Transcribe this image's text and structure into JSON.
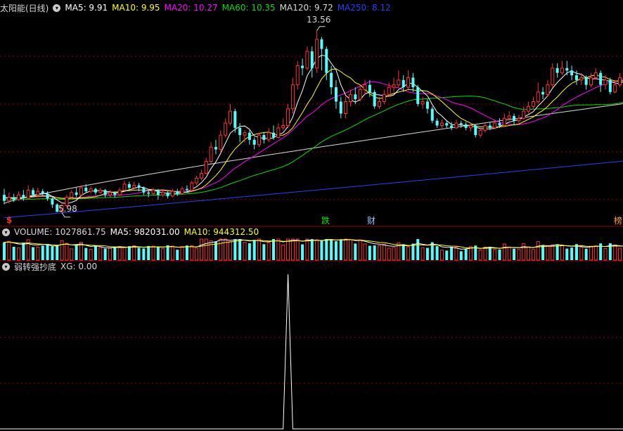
{
  "main": {
    "title": "太阳能(日线)",
    "ma": [
      {
        "label": "MA5: 9.91",
        "color": "#ffffff"
      },
      {
        "label": "MA10: 9.95",
        "color": "#ffff00"
      },
      {
        "label": "MA20: 10.27",
        "color": "#ff00ff"
      },
      {
        "label": "MA60: 10.35",
        "color": "#00e000"
      },
      {
        "label": "MA120: 9.72",
        "color": "#d8d8d8"
      },
      {
        "label": "MA250: 8.12",
        "color": "#2a3cff"
      }
    ],
    "high_label": "13.56",
    "low_label": "5.98",
    "markers": [
      {
        "text": "$",
        "color": "#ff3030"
      },
      {
        "text": "跌",
        "color": "#00e000"
      },
      {
        "text": "财",
        "color": "#9cc8ff"
      },
      {
        "text": "榜",
        "color": "#ffa040"
      }
    ]
  },
  "volume": {
    "title": "VOLUME: 1027861.75",
    "ma5": "MA5: 982031.00",
    "ma10": "MA10: 944312.50"
  },
  "indicator": {
    "title": "弱转强抄底",
    "xg": "XG: 0.00"
  },
  "colors": {
    "up": "#ff3232",
    "down": "#54fcfc",
    "grid": "#a00000",
    "separator": "#a00000"
  },
  "chart_data": {
    "type": "candlestick",
    "price_range": [
      5.5,
      14.2
    ],
    "candles": [
      [
        6.7,
        6.45,
        6.95,
        6.3
      ],
      [
        6.45,
        6.6,
        6.8,
        6.35
      ],
      [
        6.6,
        6.5,
        6.75,
        6.4
      ],
      [
        6.5,
        6.7,
        6.85,
        6.45
      ],
      [
        6.7,
        6.55,
        6.9,
        6.45
      ],
      [
        6.55,
        6.9,
        7.1,
        6.5
      ],
      [
        6.9,
        6.7,
        7.0,
        6.6
      ],
      [
        6.7,
        6.85,
        7.0,
        6.6
      ],
      [
        6.85,
        6.75,
        6.95,
        6.65
      ],
      [
        6.75,
        6.55,
        6.85,
        6.45
      ],
      [
        6.55,
        6.3,
        6.6,
        6.15
      ],
      [
        6.3,
        5.99,
        6.35,
        5.98
      ],
      [
        5.99,
        6.25,
        6.4,
        5.95
      ],
      [
        6.25,
        6.6,
        6.7,
        6.2
      ],
      [
        6.6,
        6.8,
        6.9,
        6.55
      ],
      [
        6.8,
        6.7,
        7.0,
        6.6
      ],
      [
        6.7,
        7.0,
        7.1,
        6.65
      ],
      [
        7.0,
        6.85,
        7.15,
        6.8
      ],
      [
        6.85,
        6.95,
        7.05,
        6.75
      ],
      [
        6.95,
        6.8,
        7.0,
        6.7
      ],
      [
        6.8,
        6.9,
        7.0,
        6.75
      ],
      [
        6.9,
        6.7,
        6.95,
        6.6
      ],
      [
        6.7,
        6.8,
        6.9,
        6.6
      ],
      [
        6.8,
        6.7,
        6.85,
        6.6
      ],
      [
        6.7,
        6.9,
        7.0,
        6.65
      ],
      [
        6.9,
        7.15,
        7.3,
        6.85
      ],
      [
        7.15,
        7.0,
        7.25,
        6.9
      ],
      [
        7.0,
        7.1,
        7.25,
        6.95
      ],
      [
        7.1,
        7.0,
        7.2,
        6.85
      ],
      [
        7.0,
        6.8,
        7.05,
        6.7
      ],
      [
        6.8,
        6.75,
        6.9,
        6.6
      ],
      [
        6.75,
        6.9,
        7.0,
        6.7
      ],
      [
        6.9,
        6.7,
        6.95,
        6.5
      ],
      [
        6.7,
        6.8,
        6.9,
        6.6
      ],
      [
        6.8,
        6.65,
        6.85,
        6.55
      ],
      [
        6.65,
        6.85,
        6.95,
        6.6
      ],
      [
        6.85,
        6.75,
        6.95,
        6.65
      ],
      [
        6.75,
        6.95,
        7.05,
        6.7
      ],
      [
        6.95,
        6.9,
        7.1,
        6.8
      ],
      [
        6.9,
        7.2,
        7.3,
        6.85
      ],
      [
        7.2,
        7.4,
        7.5,
        7.1
      ],
      [
        7.4,
        7.6,
        7.75,
        7.3
      ],
      [
        7.6,
        8.1,
        8.25,
        7.55
      ],
      [
        8.1,
        8.7,
        8.9,
        8.0
      ],
      [
        8.7,
        8.6,
        9.0,
        8.4
      ],
      [
        8.6,
        9.2,
        9.4,
        8.5
      ],
      [
        9.2,
        9.7,
        9.9,
        9.1
      ],
      [
        9.7,
        10.2,
        10.5,
        9.6
      ],
      [
        10.2,
        9.5,
        10.3,
        9.3
      ],
      [
        9.5,
        9.2,
        9.7,
        8.9
      ],
      [
        9.2,
        9.3,
        9.4,
        8.9
      ],
      [
        9.3,
        9.0,
        9.4,
        8.8
      ],
      [
        9.0,
        8.8,
        9.1,
        8.6
      ],
      [
        8.8,
        9.2,
        9.3,
        8.7
      ],
      [
        9.2,
        9.0,
        9.3,
        8.85
      ],
      [
        9.0,
        9.3,
        9.5,
        8.9
      ],
      [
        9.3,
        9.1,
        9.6,
        9.0
      ],
      [
        9.1,
        9.5,
        9.7,
        9.05
      ],
      [
        9.5,
        9.6,
        9.9,
        9.4
      ],
      [
        9.6,
        10.3,
        10.5,
        9.5
      ],
      [
        10.3,
        11.3,
        11.6,
        10.1
      ],
      [
        11.3,
        12.1,
        12.3,
        11.1
      ],
      [
        12.1,
        12.0,
        12.4,
        11.7
      ],
      [
        12.0,
        12.7,
        12.9,
        11.9
      ],
      [
        12.7,
        12.0,
        12.9,
        11.6
      ],
      [
        12.0,
        13.2,
        13.56,
        11.8
      ],
      [
        13.2,
        12.8,
        13.3,
        11.9
      ],
      [
        12.8,
        11.8,
        12.9,
        11.5
      ],
      [
        11.8,
        11.2,
        12.1,
        10.9
      ],
      [
        11.2,
        10.6,
        11.5,
        10.3
      ],
      [
        10.6,
        10.1,
        10.8,
        9.9
      ],
      [
        10.1,
        10.6,
        10.8,
        9.9
      ],
      [
        10.6,
        10.9,
        11.1,
        10.4
      ],
      [
        10.9,
        10.7,
        11.2,
        10.5
      ],
      [
        10.7,
        11.1,
        11.3,
        10.6
      ],
      [
        11.1,
        11.3,
        11.5,
        10.9
      ],
      [
        11.3,
        11.0,
        11.5,
        10.8
      ],
      [
        11.0,
        10.4,
        11.1,
        10.3
      ],
      [
        10.4,
        10.6,
        10.8,
        10.3
      ],
      [
        10.6,
        10.9,
        11.1,
        10.5
      ],
      [
        10.9,
        11.2,
        11.4,
        10.8
      ],
      [
        11.2,
        11.3,
        11.6,
        11.0
      ],
      [
        11.3,
        11.5,
        11.9,
        11.2
      ],
      [
        11.5,
        11.2,
        11.7,
        11.0
      ],
      [
        11.2,
        11.6,
        11.9,
        11.1
      ],
      [
        11.6,
        11.2,
        11.8,
        11.0
      ],
      [
        11.2,
        10.5,
        11.3,
        10.4
      ],
      [
        10.5,
        10.6,
        10.8,
        10.3
      ],
      [
        10.6,
        10.3,
        10.7,
        10.1
      ],
      [
        10.3,
        9.8,
        10.4,
        9.7
      ],
      [
        9.8,
        9.6,
        9.9,
        9.5
      ],
      [
        9.6,
        9.7,
        9.85,
        9.5
      ],
      [
        9.7,
        9.6,
        9.8,
        9.5
      ],
      [
        9.6,
        9.5,
        9.75,
        9.4
      ],
      [
        9.5,
        9.7,
        9.85,
        9.45
      ],
      [
        9.7,
        9.65,
        9.8,
        9.5
      ],
      [
        9.65,
        9.5,
        9.75,
        9.4
      ],
      [
        9.5,
        9.6,
        9.7,
        9.35
      ],
      [
        9.6,
        9.2,
        9.65,
        9.1
      ],
      [
        9.2,
        9.4,
        9.5,
        9.1
      ],
      [
        9.4,
        9.6,
        9.7,
        9.3
      ],
      [
        9.6,
        9.5,
        9.75,
        9.4
      ],
      [
        9.5,
        9.7,
        9.85,
        9.45
      ],
      [
        9.7,
        9.6,
        9.9,
        9.5
      ],
      [
        9.6,
        9.9,
        10.1,
        9.55
      ],
      [
        9.9,
        10.0,
        10.2,
        9.8
      ],
      [
        10.0,
        9.8,
        10.1,
        9.6
      ],
      [
        9.8,
        9.9,
        10.05,
        9.7
      ],
      [
        9.9,
        10.2,
        10.4,
        9.85
      ],
      [
        10.2,
        10.4,
        10.6,
        10.1
      ],
      [
        10.4,
        10.6,
        10.8,
        10.3
      ],
      [
        10.6,
        11.0,
        11.4,
        10.5
      ],
      [
        11.0,
        10.9,
        11.2,
        10.7
      ],
      [
        10.9,
        11.3,
        11.5,
        10.8
      ],
      [
        11.3,
        12.0,
        12.2,
        11.2
      ],
      [
        12.0,
        11.8,
        12.2,
        11.6
      ],
      [
        11.8,
        12.0,
        12.3,
        11.7
      ],
      [
        12.0,
        11.9,
        12.3,
        11.7
      ],
      [
        11.9,
        11.7,
        12.1,
        11.5
      ],
      [
        11.7,
        11.5,
        11.9,
        11.3
      ],
      [
        11.5,
        11.6,
        11.8,
        11.3
      ],
      [
        11.6,
        11.3,
        11.7,
        11.1
      ],
      [
        11.3,
        11.6,
        11.8,
        11.2
      ],
      [
        11.6,
        11.8,
        12.0,
        11.5
      ],
      [
        11.8,
        11.3,
        11.9,
        11.0
      ],
      [
        11.3,
        11.5,
        11.7,
        11.1
      ],
      [
        11.5,
        11.0,
        11.6,
        10.9
      ],
      [
        11.0,
        11.3,
        11.5,
        10.95
      ],
      [
        11.3,
        11.6,
        11.8,
        11.2
      ],
      [
        11.6,
        12.0,
        12.2,
        11.4
      ]
    ],
    "ma_current": {
      "MA5": 9.91,
      "MA10": 9.95,
      "MA20": 10.27,
      "MA60": 10.35,
      "MA120": 9.72,
      "MA250": 8.12
    },
    "volume_latest": 1027861.75,
    "volume_ma5": 982031.0,
    "volume_ma10": 944312.5,
    "xg_signal_index": 59,
    "xg_latest": 0.0
  }
}
